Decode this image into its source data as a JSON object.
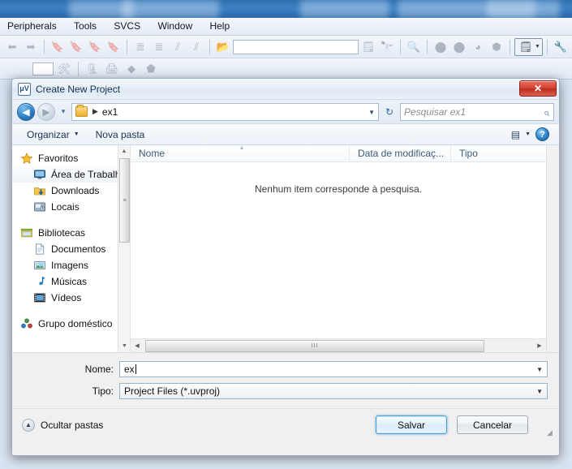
{
  "background_app": {
    "menu_items": [
      "Peripherals",
      "Tools",
      "SVCS",
      "Window",
      "Help"
    ],
    "toolbar_combo_value": "",
    "toolbar_small_combo_value": ""
  },
  "dialog": {
    "title": "Create New Project",
    "window_icon_name": "uvision-icon",
    "close_label": "✕",
    "nav": {
      "back_label": "◀",
      "forward_label": "▶",
      "history_dropdown_label": "▾",
      "refresh_label": "↻",
      "breadcrumb_separator": "▶",
      "breadcrumb_path": "ex1",
      "address_caret": "▼"
    },
    "search": {
      "placeholder": "Pesquisar ex1",
      "value": "",
      "icon_label": "⌕"
    },
    "command_bar": {
      "organize_label": "Organizar",
      "organize_caret": "▼",
      "new_folder_label": "Nova pasta",
      "view_caret": "▼",
      "help_label": "?"
    },
    "sidebar": {
      "groups": [
        {
          "header": "Favoritos",
          "header_icon": "star-icon",
          "items": [
            {
              "label": "Área de Trabalho",
              "icon": "desktop-icon",
              "selected": true
            },
            {
              "label": "Downloads",
              "icon": "downloads-folder-icon",
              "selected": false
            },
            {
              "label": "Locais",
              "icon": "recent-places-icon",
              "selected": false
            }
          ]
        },
        {
          "header": "Bibliotecas",
          "header_icon": "libraries-icon",
          "items": [
            {
              "label": "Documentos",
              "icon": "documents-icon",
              "selected": false
            },
            {
              "label": "Imagens",
              "icon": "pictures-icon",
              "selected": false
            },
            {
              "label": "Músicas",
              "icon": "music-icon",
              "selected": false
            },
            {
              "label": "Vídeos",
              "icon": "videos-icon",
              "selected": false
            }
          ]
        },
        {
          "header": "Grupo doméstico",
          "header_icon": "homegroup-icon",
          "items": []
        }
      ],
      "scroll_up_label": "▲",
      "scroll_down_label": "▼",
      "thumb_grip_label": "≡"
    },
    "file_list": {
      "columns": [
        "Nome",
        "Data de modificaç...",
        "Tipo"
      ],
      "sort_indicator": "▴",
      "rows": [],
      "empty_message": "Nenhum item corresponde à pesquisa.",
      "hscroll_left_label": "◀",
      "hscroll_right_label": "▶",
      "hscroll_grip_label": "III"
    },
    "form": {
      "name_label": "Nome:",
      "name_value": "ex",
      "name_caret": "▼",
      "type_label": "Tipo:",
      "type_value": "Project Files (*.uvproj)",
      "type_caret": "▼"
    },
    "footer": {
      "hide_folders_label": "Ocultar pastas",
      "hide_folders_icon": "▲",
      "save_label": "Salvar",
      "cancel_label": "Cancelar",
      "resize_grip": "◢"
    }
  },
  "colors": {
    "desktop_blue": "#3d82c4",
    "dialog_bg": "#f0f0f0",
    "accent_blue": "#2b7fc4",
    "close_red": "#d6402f",
    "default_button_border": "#4f9fd4",
    "column_header_text": "#3b5a77"
  }
}
